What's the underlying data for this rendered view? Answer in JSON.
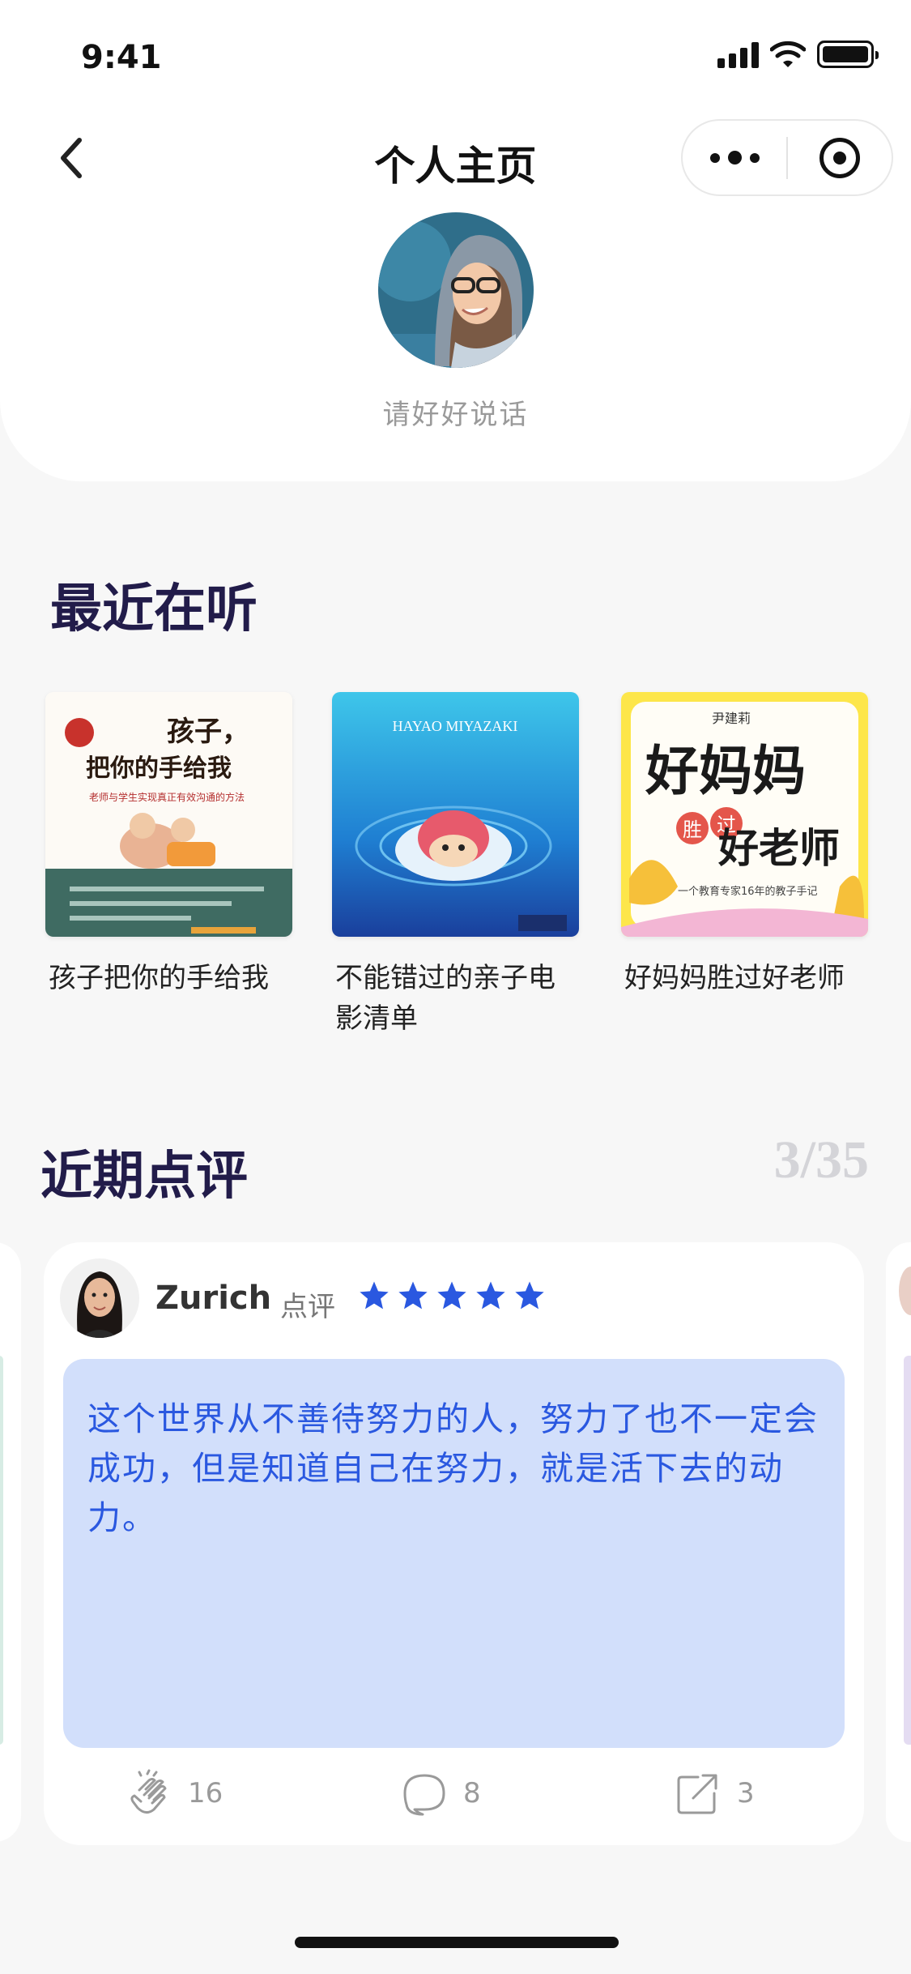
{
  "status_bar": {
    "time": "9:41"
  },
  "nav": {
    "title": "个人主页"
  },
  "profile": {
    "bio": "请好好说话"
  },
  "listening": {
    "title": "最近在听",
    "books": [
      {
        "title": "孩子把你的手给我",
        "cover_lines": [
          "孩子，",
          "把你的手给我",
          "老师与学生实现真正有效沟通的方法"
        ]
      },
      {
        "title": "不能错过的亲子电影清单",
        "cover_lines": [
          "HAYAO MIYAZAKI"
        ]
      },
      {
        "title": "好妈妈胜过好老师",
        "cover_lines": [
          "尹建莉",
          "好妈妈",
          "胜",
          "过",
          "好老师",
          "一个教育专家16年的教子手记"
        ]
      }
    ]
  },
  "reviews": {
    "title": "近期点评",
    "counter": "3/35",
    "current": {
      "user": "Zurich",
      "tag": "点评",
      "rating": 5,
      "text": "这个世界从不善待努力的人，努力了也不一定会成功，但是知道自己在努力，就是活下去的动力。",
      "claps": "16",
      "comments": "8",
      "shares": "3"
    }
  },
  "colors": {
    "accent": "#2a58e0",
    "quote_bg": "#d2dffb",
    "title": "#221c4a"
  },
  "icons": [
    "back-icon",
    "more-icon",
    "record-icon",
    "star-icon",
    "clap-icon",
    "comment-icon",
    "share-icon"
  ]
}
